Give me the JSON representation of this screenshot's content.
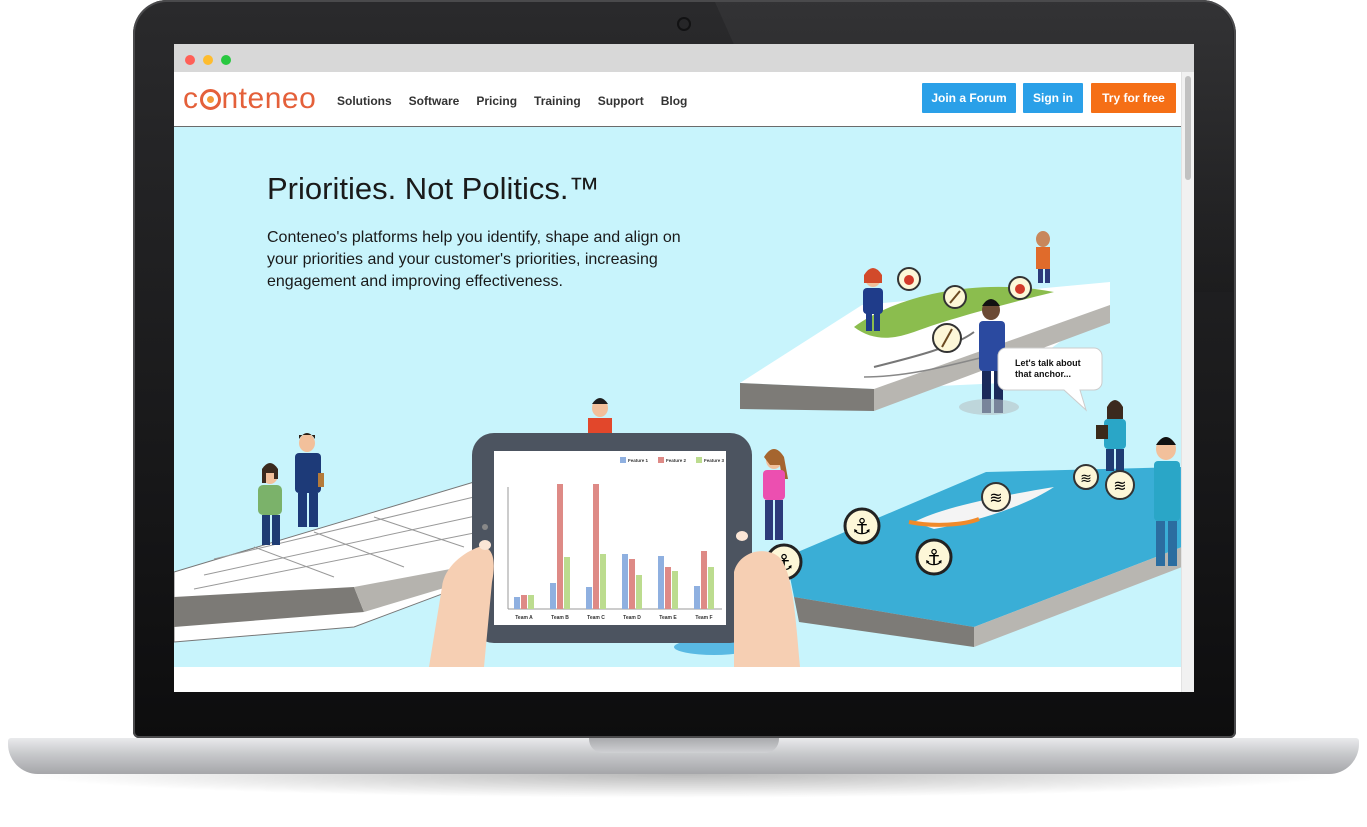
{
  "brand": {
    "logo_prefix": "c",
    "logo_suffix": "nteneo",
    "color": "#e4603a"
  },
  "nav": {
    "items": [
      {
        "label": "Solutions"
      },
      {
        "label": "Software"
      },
      {
        "label": "Pricing"
      },
      {
        "label": "Training"
      },
      {
        "label": "Support"
      },
      {
        "label": "Blog"
      }
    ],
    "join_label": "Join a Forum",
    "signin_label": "Sign in",
    "try_label": "Try for free",
    "colors": {
      "join": "#2aa0e8",
      "signin": "#2aa0e8",
      "try": "#f56f16"
    }
  },
  "hero": {
    "title": "Priorities. Not Politics.™",
    "text": "Conteneo's platforms help you identify, shape and align on your priorities and your customer's priorities, increasing engagement and improving effectiveness.",
    "speech": "Let's talk about that anchor...",
    "background": "#c8f4fc"
  },
  "tablet_chart": {
    "legend": [
      "Feature 1",
      "Feature 2",
      "Feature 3"
    ],
    "categories": [
      "Team A",
      "Team B",
      "Team C",
      "Team D",
      "Team E",
      "Team F"
    ],
    "colors": [
      "#8fb0e0",
      "#de8a86",
      "#bcdc8f"
    ]
  }
}
